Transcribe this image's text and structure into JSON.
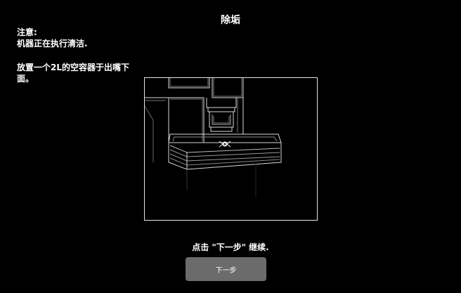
{
  "header": {
    "title": "除垢"
  },
  "notice": {
    "heading": "注意:",
    "line1": "机器正在执行清洁.",
    "line2": "放置一个2L的空容器于出嘴下面。"
  },
  "instruction": "点击 \"下一步\" 继续.",
  "actions": {
    "next_label": "下一步"
  },
  "illustration": {
    "icon": "coffee-machine-drip-tray-icon"
  }
}
